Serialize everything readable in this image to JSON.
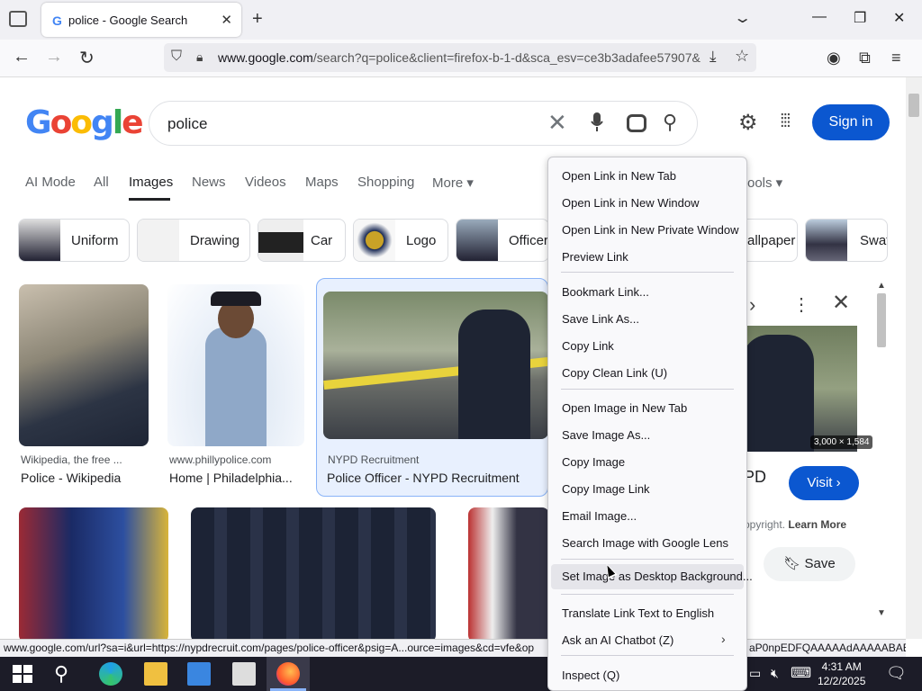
{
  "browser": {
    "tab_title": "police - Google Search",
    "tab_favicon": "G",
    "new_tab": "+",
    "url_domain": "www.google.com",
    "url_rest": "/search?q=police&client=firefox-b-1-d&sca_esv=ce3b3adafee57907&"
  },
  "google": {
    "logo": "Google",
    "query": "police",
    "sign_in": "Sign in",
    "tabs": [
      "AI Mode",
      "All",
      "Images",
      "News",
      "Videos",
      "Maps",
      "Shopping",
      "More ▾"
    ],
    "tools": "ools ▾",
    "chips": [
      "Uniform",
      "Drawing",
      "Car",
      "Logo",
      "Officer",
      "allpaper",
      "Swat"
    ]
  },
  "results": [
    {
      "source": "Wikipedia, the free ...",
      "title": "Police - Wikipedia"
    },
    {
      "source": "www.phillypolice.com",
      "title": "Home | Philadelphia..."
    },
    {
      "source": "NYPD Recruitment",
      "title": "Police Officer - NYPD Recruitment"
    }
  ],
  "panel": {
    "dims": "3,000 × 1,584",
    "title": "PD",
    "visit": "Visit",
    "copyright": "opyright.",
    "learn_more": "Learn More",
    "save": "Save"
  },
  "context_menu": [
    "Open Link in New Tab",
    "Open Link in New Window",
    "Open Link in New Private Window",
    "Preview Link",
    "Bookmark Link...",
    "Save Link As...",
    "Copy Link",
    "Copy Clean Link (U)",
    "Open Image in New Tab",
    "Save Image As...",
    "Copy Image",
    "Copy Image Link",
    "Email Image...",
    "Search Image with Google Lens",
    "Set Image as Desktop Background...",
    "Translate Link Text to English",
    "Ask an AI Chatbot (Z)",
    "Inspect (Q)"
  ],
  "status": {
    "url": "www.google.com/url?sa=i&url=https://nypdrecruit.com/pages/police-officer&psig=A...ource=images&cd=vfe&op",
    "right": "aP0npEDFQAAAAAdAAAAABAE"
  },
  "taskbar": {
    "time": "4:31 AM",
    "date": "12/2/2025"
  },
  "colors": {
    "accent": "#0b57d0",
    "menu_bg": "#f9f9fb",
    "menu_highlight": "#e5e5ea"
  }
}
